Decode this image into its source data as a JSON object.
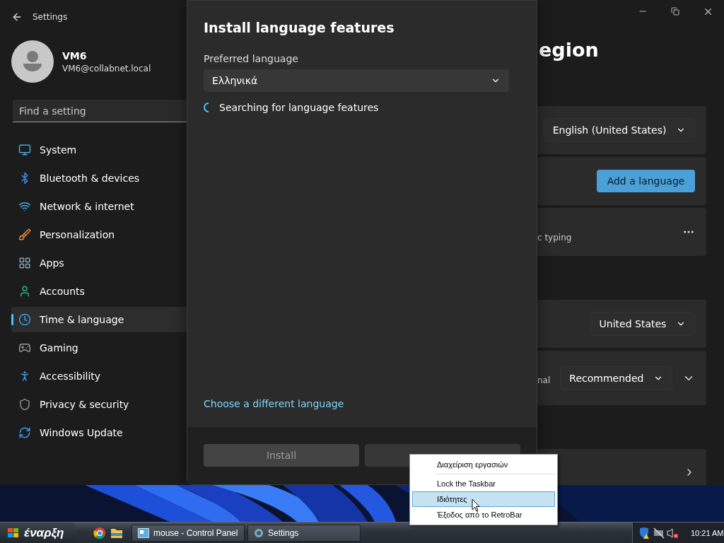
{
  "window": {
    "title": "Settings"
  },
  "profile": {
    "name": "VM6",
    "email": "VM6@collabnet.local"
  },
  "search": {
    "placeholder": "Find a setting"
  },
  "nav": [
    {
      "label": "System",
      "kind": "system",
      "selected": false
    },
    {
      "label": "Bluetooth & devices",
      "kind": "bluetooth",
      "selected": false
    },
    {
      "label": "Network & internet",
      "kind": "network",
      "selected": false
    },
    {
      "label": "Personalization",
      "kind": "personalization",
      "selected": false
    },
    {
      "label": "Apps",
      "kind": "apps",
      "selected": false
    },
    {
      "label": "Accounts",
      "kind": "accounts",
      "selected": false
    },
    {
      "label": "Time & language",
      "kind": "time",
      "selected": true
    },
    {
      "label": "Gaming",
      "kind": "gaming",
      "selected": false
    },
    {
      "label": "Accessibility",
      "kind": "accessibility",
      "selected": false
    },
    {
      "label": "Privacy & security",
      "kind": "privacy",
      "selected": false
    },
    {
      "label": "Windows Update",
      "kind": "update",
      "selected": false
    }
  ],
  "page": {
    "title": "egion",
    "sections": [
      {
        "rows": [
          {
            "kind": "dropdown",
            "value": "English (United States)"
          },
          {
            "kind": "button",
            "label": "Add a language"
          },
          {
            "kind": "more",
            "text": "c typing"
          }
        ]
      },
      {
        "rows": [
          {
            "kind": "dropdown",
            "value": "United States"
          },
          {
            "kind": "dropdown-expand",
            "text": "nal",
            "value": "Recommended"
          }
        ]
      },
      {
        "rows": [
          {
            "kind": "link"
          }
        ]
      }
    ]
  },
  "dialog": {
    "title": "Install language features",
    "field_label": "Preferred language",
    "selected_language": "Ελληνικά",
    "status": "Searching for language features",
    "link": "Choose a different language",
    "buttons": [
      {
        "label": "Install",
        "disabled": true
      },
      {
        "disabled": false
      }
    ]
  },
  "context_menu": {
    "items": [
      {
        "label": "Διαχείριση εργασιών",
        "selected": false,
        "separator_after": true
      },
      {
        "label": "Lock the Taskbar",
        "selected": false,
        "separator_after": false
      },
      {
        "label": "Ιδιότητες",
        "selected": true,
        "separator_after": false
      },
      {
        "label": "Έξοδος από το RetroBar",
        "selected": false,
        "separator_after": false
      }
    ]
  },
  "taskbar": {
    "start": "έναρξη",
    "quick_launch": [
      {
        "kind": "chrome"
      },
      {
        "kind": "folder"
      }
    ],
    "tasks": [
      {
        "label": "mouse - Control Panel",
        "kind": "control-panel"
      },
      {
        "label": "Settings",
        "kind": "settings"
      }
    ],
    "clock": "10:21 AM"
  }
}
